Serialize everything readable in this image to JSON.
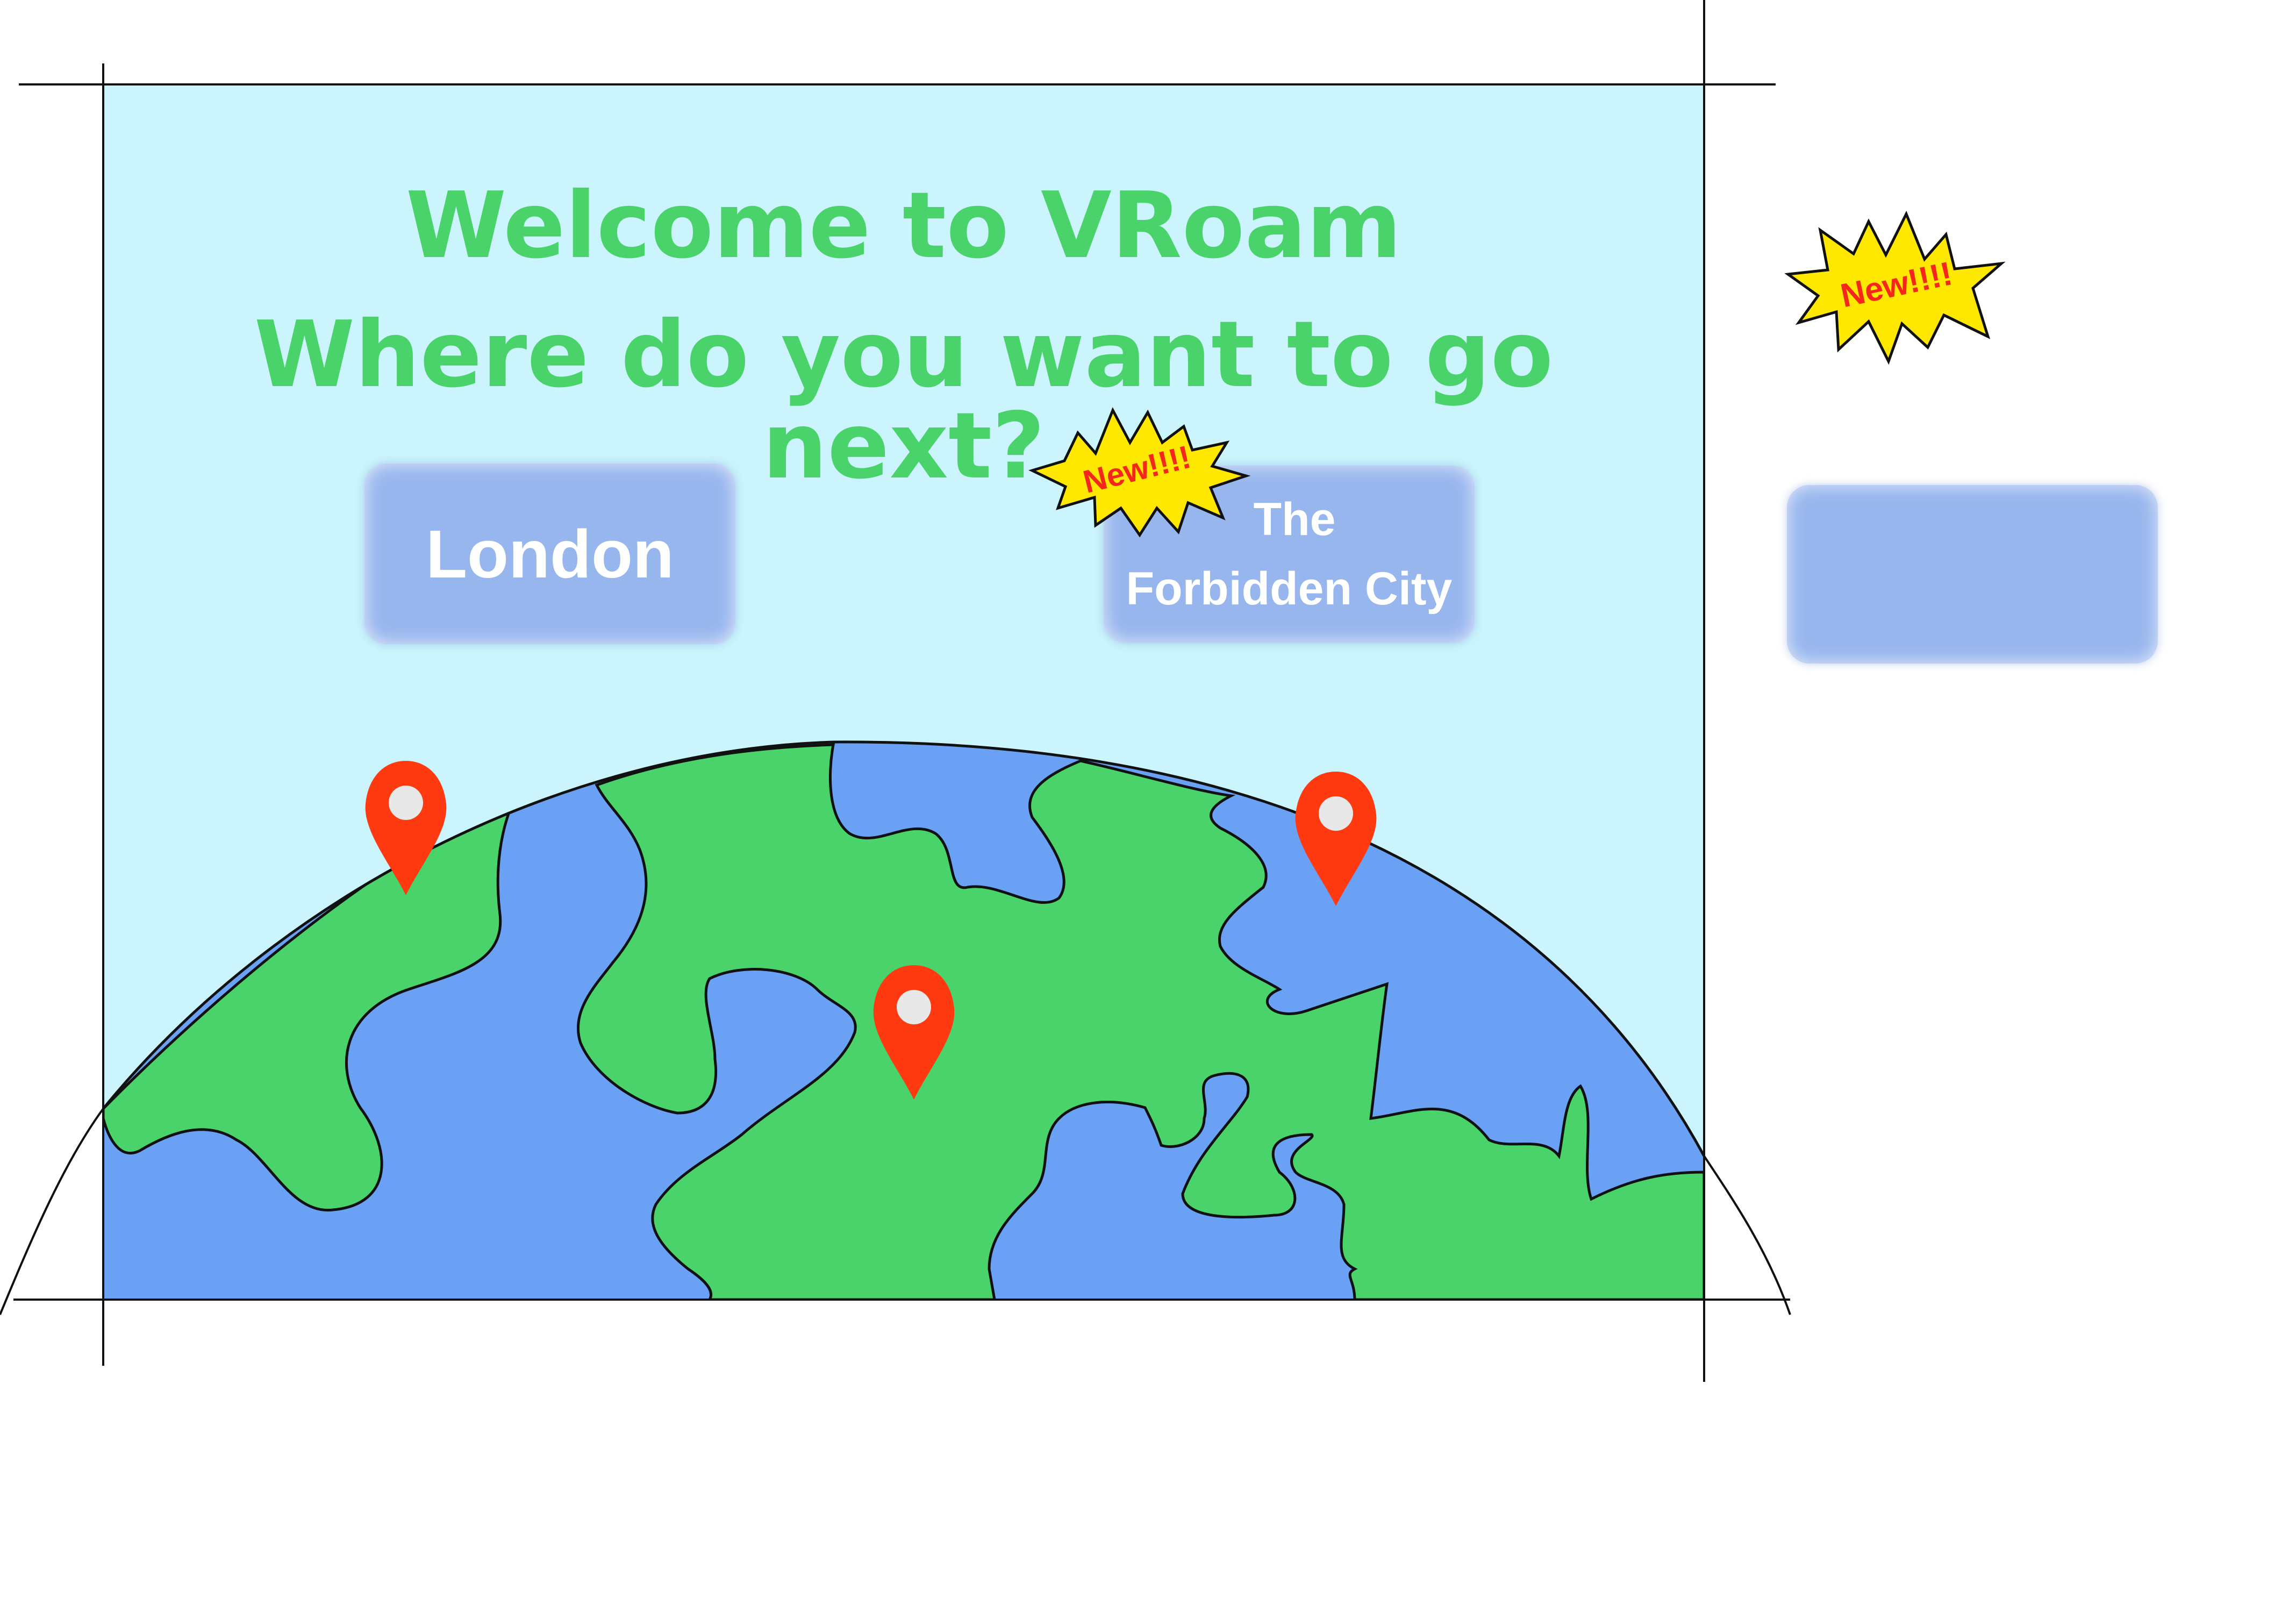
{
  "header": {
    "title_line1": "Welcome to VRoam",
    "title_line2": "Where do you want to go next?"
  },
  "destinations": [
    {
      "label": "London"
    },
    {
      "label_line1": "The",
      "label_line2": "Forbidden City",
      "badge": "New!!!!"
    },
    {
      "label": "",
      "badge": "New!!!!"
    }
  ],
  "colors": {
    "background": "#cbf4fc",
    "title": "#4ad36b",
    "button": "#98b6ee",
    "land": "#4ad36b",
    "ocean": "#6aa1f5",
    "pin": "#ff3a10",
    "badge_fill": "#ffe800",
    "badge_text": "#f4271a"
  },
  "map": {
    "pins": [
      "location-pin",
      "location-pin",
      "location-pin"
    ]
  }
}
